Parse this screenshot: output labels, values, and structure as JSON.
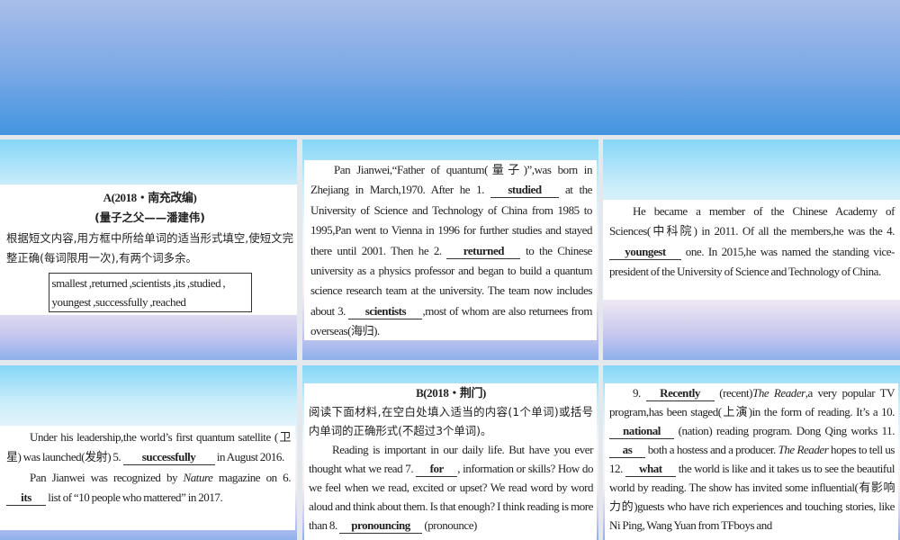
{
  "section_a": {
    "title": "A(2018・南充改编)",
    "subtitle": "(量子之父——潘建伟)",
    "instructions": "根据短文内容,用方框中所给单词的适当形式填空,使短文完整正确(每词限用一次),有两个词多余。",
    "word_box": [
      "smallest ,returned ,scientists ,its ,studied ,",
      "youngest ,successfully ,reached"
    ]
  },
  "passages": [
    {
      "panel": "p2",
      "paragraphs": [
        [
          {
            "t": "Pan Jianwei,“Father of quantum(量子)”,was born in Zhejiang in March,1970. After he 1. "
          },
          {
            "b": "studied",
            "w": 70
          },
          {
            "t": " at the University of Science and Technology of China from 1985 to 1995,Pan went to Vienna in 1996 for further studies and stayed there until 2001. Then he 2. "
          },
          {
            "b": "returned",
            "w": 76
          },
          {
            "t": " to the Chinese university as a physics professor and began to build a quantum science research team at the university. The team now includes about 3. "
          },
          {
            "b": "scientists",
            "w": 76
          },
          {
            "t": ",most of whom are also returnees from overseas(海归)."
          }
        ]
      ]
    },
    {
      "panel": "p3",
      "paragraphs": [
        [
          {
            "t": "He became a member of the Chinese Academy of Sciences(中科院) in 2011. Of all the members,he was the 4. "
          },
          {
            "b": "youngest",
            "w": 74
          },
          {
            "t": " one. In 2015,he was named the standing vice-president of the University of Science and Technology of China."
          }
        ]
      ]
    },
    {
      "panel": "p4",
      "paragraphs": [
        [
          {
            "t": "Under his leadership,the world’s first quantum satellite (卫星) was launched(发射) 5. "
          },
          {
            "b": "successfully",
            "w": 96
          },
          {
            "t": " in August 2016."
          }
        ],
        [
          {
            "t": "Pan Jianwei was recognized by "
          },
          {
            "i": "Nature"
          },
          {
            "t": " magazine on 6. "
          },
          {
            "b": "its",
            "w": 38
          },
          {
            "t": " list of “10 people who mattered” in 2017."
          }
        ]
      ]
    },
    {
      "panel": "p5",
      "paragraphs": [
        [
          {
            "t": "Reading is important in our daily life. But have you ever thought what we read 7. "
          },
          {
            "b": "for",
            "w": 40
          },
          {
            "t": ", information or skills? How do we feel when we read, excited or upset? We read word by word aloud and think about them. Is that enough? I think reading is more than 8. "
          },
          {
            "b": "pronouncing",
            "w": 86
          },
          {
            "t": " (pronounce)"
          }
        ]
      ]
    },
    {
      "panel": "p6",
      "paragraphs": [
        [
          {
            "t": "9. "
          },
          {
            "b": "Recently",
            "w": 70
          },
          {
            "t": " (recent)"
          },
          {
            "i": "The Reader"
          },
          {
            "t": ",a very popular TV program,has been staged(上演)in the form of reading. It’s a 10. "
          },
          {
            "b": "national",
            "w": 66
          },
          {
            "t": " (nation) reading program. Dong Qing works 11. "
          },
          {
            "b": "as",
            "w": 34
          },
          {
            "t": " both a hostess and a producer. "
          },
          {
            "i": "The Reader"
          },
          {
            "t": " hopes to tell us 12. "
          },
          {
            "b": "what",
            "w": 50
          },
          {
            "t": " the world is like and it takes us to see the beautiful world by reading. The show has invited some influential(有影响力的)guests who have rich experiences and touching stories, like Ni Ping, Wang Yuan from TFboys and"
          }
        ]
      ]
    }
  ],
  "section_b": {
    "title": "B(2018・荆门)",
    "instructions": "阅读下面材料,在空白处填入适当的内容(1个单词)或括号内单词的正确形式(不超过3个单词)。"
  }
}
